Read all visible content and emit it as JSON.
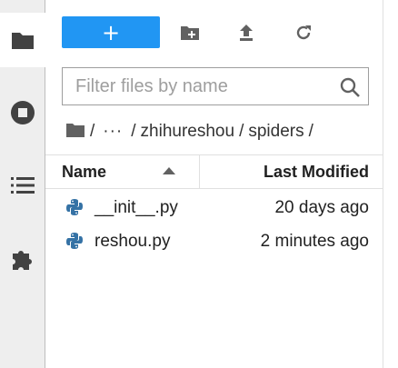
{
  "toolbar": {
    "new_label": "+",
    "new_folder_icon": "new-folder-icon",
    "upload_icon": "upload-icon",
    "refresh_icon": "refresh-icon"
  },
  "filter": {
    "placeholder": "Filter files by name",
    "value": ""
  },
  "breadcrumbs": {
    "root": "/",
    "ellipsis": "···",
    "parts": [
      "zhihureshou",
      "spiders"
    ],
    "sep": "/"
  },
  "table": {
    "columns": [
      "Name",
      "Last Modified"
    ],
    "sort_column": "Name",
    "rows": [
      {
        "name": "__init__.py",
        "modified": "20 days ago",
        "icon": "python-icon"
      },
      {
        "name": "reshou.py",
        "modified": "2 minutes ago",
        "icon": "python-icon"
      }
    ]
  },
  "colors": {
    "accent": "#2196f3",
    "sidebar_bg": "#eeeeee",
    "icon": "#616161",
    "python_blue": "#3572a5"
  }
}
